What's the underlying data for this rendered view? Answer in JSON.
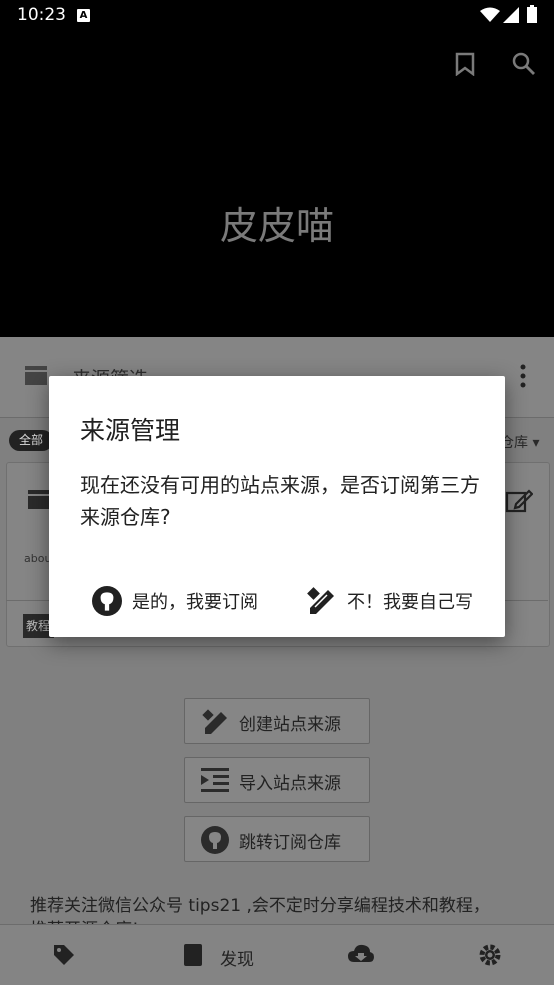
{
  "status_bar": {
    "time": "10:23",
    "notification_badge": "A"
  },
  "header": {
    "title": "皮皮喵"
  },
  "filter": {
    "title": "来源筛选",
    "chip_all": "全部",
    "repo_dropdown": "仓库"
  },
  "card": {
    "about_text": "abou",
    "badge": "教程"
  },
  "actions": {
    "create_label": "创建站点来源",
    "import_label": "导入站点来源",
    "jump_label": "跳转订阅仓库"
  },
  "recommend": {
    "line1": "推荐关注微信公众号 tips21 ,会不定时分享编程技术和教程，",
    "line2": "推荐开源仓库!"
  },
  "bottom_nav": {
    "discover_label": "发现"
  },
  "dialog": {
    "title": "来源管理",
    "message": "现在还没有可用的站点来源，是否订阅第三方来源仓库?",
    "positive_label": "是的，我要订阅",
    "negative_label": "不！我要自己写"
  }
}
